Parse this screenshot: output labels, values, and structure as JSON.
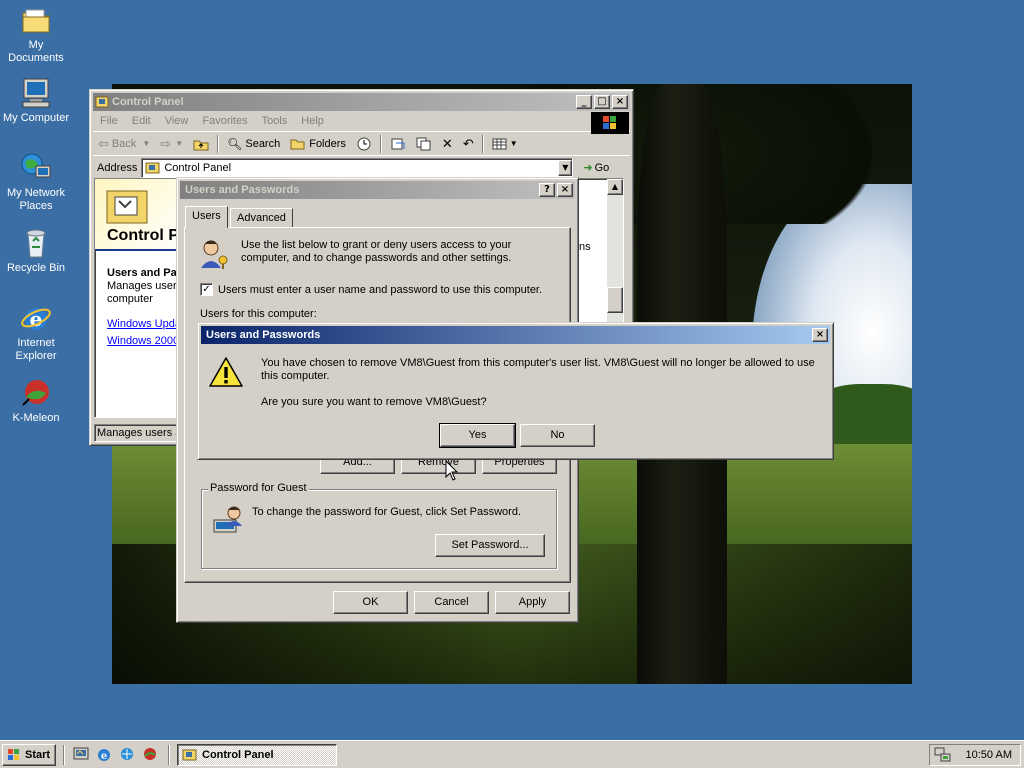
{
  "desktop": {
    "icons": [
      {
        "label": "My Documents"
      },
      {
        "label": "My Computer"
      },
      {
        "label": "My Network Places"
      },
      {
        "label": "Recycle Bin"
      },
      {
        "label": "Internet Explorer"
      },
      {
        "label": "K-Meleon"
      }
    ]
  },
  "control_panel": {
    "title": "Control Panel",
    "menu": [
      "File",
      "Edit",
      "View",
      "Favorites",
      "Tools",
      "Help"
    ],
    "toolbar": {
      "back": "Back",
      "search": "Search",
      "folders": "Folders"
    },
    "address_label": "Address",
    "address_value": "Control Panel",
    "go_label": "Go",
    "heading": "Control P",
    "section_title": "Users and Pa",
    "section_desc_1": "Manages users",
    "section_desc_2": "computer",
    "link_1": "Windows Upda",
    "link_2": "Windows 2000",
    "right_fragment": "ns",
    "status_text": "Manages users ar"
  },
  "users_dialog": {
    "title": "Users and Passwords",
    "tabs": [
      "Users",
      "Advanced"
    ],
    "intro": "Use the list below to grant or deny users access to your computer, and to change passwords and other settings.",
    "checkbox_label": "Users must enter a user name and password to use this computer.",
    "checkbox_checked": true,
    "users_label": "Users for this computer:",
    "add_button": "Add...",
    "remove_button": "Remove",
    "properties_button": "Properties",
    "password_group": "Password for Guest",
    "password_text": "To change the password for Guest, click Set Password.",
    "set_password_button": "Set Password...",
    "ok_button": "OK",
    "cancel_button": "Cancel",
    "apply_button": "Apply"
  },
  "confirm_dialog": {
    "title": "Users and Passwords",
    "message": "You have chosen to remove VM8\\Guest from this computer's user list. VM8\\Guest will no longer be allowed to use this computer.",
    "question": "Are you sure you want to remove VM8\\Guest?",
    "yes_button": "Yes",
    "no_button": "No"
  },
  "taskbar": {
    "start_label": "Start",
    "task_label": "Control Panel",
    "clock": "10:50 AM"
  },
  "colors": {
    "desktop": "#3a6ea5",
    "title_active": "#0a246a",
    "title_inactive": "#808080",
    "face": "#d4d0c8",
    "link": "#0000ff"
  }
}
